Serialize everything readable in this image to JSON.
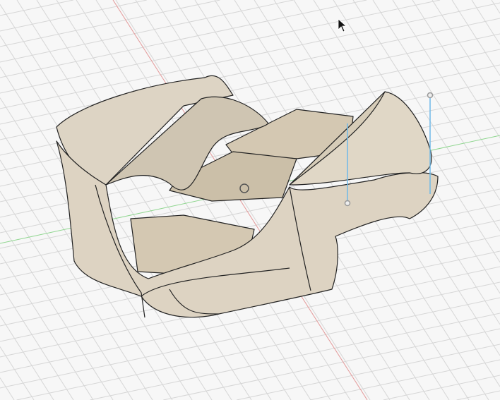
{
  "viewport": {
    "background_color": "#f7f7f7",
    "grid_color": "#d6d6d6",
    "x_axis_color": "#e08080",
    "y_axis_color": "#7fd07f",
    "model_color": "#d9d0bf",
    "model_shadow_color": "#b9ae98",
    "edge_color": "#222222",
    "manipulator_color": "#6fb9e8"
  },
  "icons": [
    "mouse-cursor-icon",
    "origin-point-icon",
    "manipulator-handle-icon"
  ]
}
